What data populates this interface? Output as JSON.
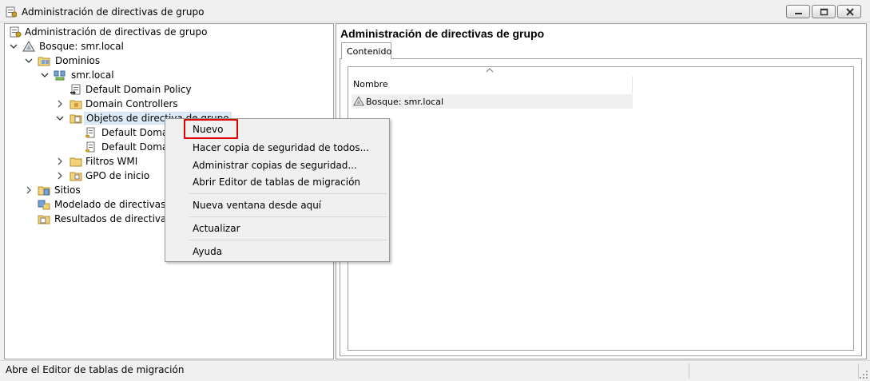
{
  "window": {
    "title": "Administración de directivas de grupo",
    "app_icon": "gpmc-icon"
  },
  "tree": [
    {
      "id": "root",
      "label": "Administración de directivas de grupo",
      "icon": "gpmc-icon",
      "expanded": null
    },
    {
      "id": "forest",
      "label": "Bosque: smr.local",
      "icon": "forest-icon",
      "expanded": true
    },
    {
      "id": "domains",
      "label": "Dominios",
      "icon": "domains-folder-icon",
      "expanded": true
    },
    {
      "id": "domain",
      "label": "smr.local",
      "icon": "domain-icon",
      "expanded": true
    },
    {
      "id": "ddp",
      "label": "Default Domain Policy",
      "icon": "gpo-link-icon",
      "expanded": null
    },
    {
      "id": "dc",
      "label": "Domain Controllers",
      "icon": "ou-folder-icon",
      "expanded": false
    },
    {
      "id": "gpo-objects",
      "label": "Objetos de directiva de grupo",
      "icon": "gpo-folder-icon",
      "expanded": true
    },
    {
      "id": "gpo1",
      "label": "Default Domain",
      "icon": "gpo-icon",
      "expanded": null
    },
    {
      "id": "gpo2",
      "label": "Default Domain",
      "icon": "gpo-icon",
      "expanded": null
    },
    {
      "id": "wmi",
      "label": "Filtros WMI",
      "icon": "folder-icon",
      "expanded": false
    },
    {
      "id": "starter",
      "label": "GPO de inicio",
      "icon": "folder-icon",
      "expanded": false
    },
    {
      "id": "sites",
      "label": "Sitios",
      "icon": "sites-icon",
      "expanded": false
    },
    {
      "id": "modeling",
      "label": "Modelado de directivas de",
      "icon": "modeling-icon",
      "expanded": null
    },
    {
      "id": "results",
      "label": "Resultados de directivas d",
      "icon": "results-icon",
      "expanded": null
    }
  ],
  "context_menu": {
    "items": [
      {
        "label": "Nuevo",
        "highlighted": true
      },
      {
        "label": "Hacer copia de seguridad de todos..."
      },
      {
        "label": "Administrar copias de seguridad..."
      },
      {
        "label": "Abrir Editor de tablas de migración"
      },
      {
        "separator": true
      },
      {
        "label": "Nueva ventana desde aquí"
      },
      {
        "separator": true
      },
      {
        "label": "Actualizar"
      },
      {
        "separator": true
      },
      {
        "label": "Ayuda"
      }
    ]
  },
  "right_pane": {
    "title": "Administración de directivas de grupo",
    "tab": "Contenido",
    "column_header": "Nombre",
    "rows": [
      {
        "label": "Bosque: smr.local",
        "icon": "forest-icon"
      }
    ]
  },
  "statusbar": {
    "text": "Abre el Editor de tablas de migración"
  },
  "colors": {
    "highlight_box": "#e00000",
    "selected_item_bg": "#ddeaf7"
  }
}
